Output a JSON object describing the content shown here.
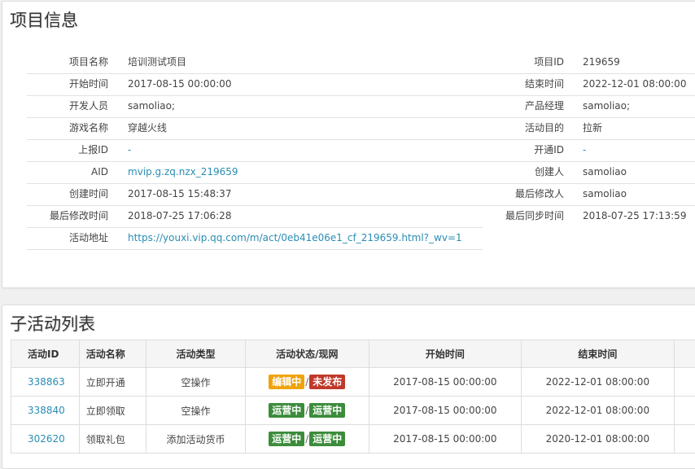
{
  "project_info": {
    "title": "项目信息",
    "left_rows": [
      {
        "label": "项目名称",
        "value": "培训测试项目",
        "link": false
      },
      {
        "label": "开始时间",
        "value": "2017-08-15 00:00:00",
        "link": false
      },
      {
        "label": "开发人员",
        "value": "samoliao;",
        "link": false
      },
      {
        "label": "游戏名称",
        "value": "穿越火线",
        "link": false
      },
      {
        "label": "上报ID",
        "value": "-",
        "link": true
      },
      {
        "label": "AID",
        "value": "mvip.g.zq.nzx_219659",
        "link": true
      },
      {
        "label": "创建时间",
        "value": "2017-08-15 15:48:37",
        "link": false
      },
      {
        "label": "最后修改时间",
        "value": "2018-07-25 17:06:28",
        "link": false
      },
      {
        "label": "活动地址",
        "value": "https://youxi.vip.qq.com/m/act/0eb41e06e1_cf_219659.html?_wv=1",
        "link": true
      }
    ],
    "right_rows": [
      {
        "label": "项目ID",
        "value": "219659",
        "link": false
      },
      {
        "label": "结束时间",
        "value": "2022-12-01 08:00:00",
        "link": false
      },
      {
        "label": "产品经理",
        "value": "samoliao;",
        "link": false
      },
      {
        "label": "活动目的",
        "value": "拉新",
        "link": false
      },
      {
        "label": "开通ID",
        "value": "-",
        "link": true
      },
      {
        "label": "创建人",
        "value": "samoliao",
        "link": false
      },
      {
        "label": "最后修改人",
        "value": "samoliao",
        "link": false
      },
      {
        "label": "最后同步时间",
        "value": "2018-07-25 17:13:59",
        "link": false
      }
    ]
  },
  "sub_activities": {
    "title": "子活动列表",
    "columns": [
      "活动ID",
      "活动名称",
      "活动类型",
      "活动状态/现网",
      "开始时间",
      "结束时间"
    ],
    "rows": [
      {
        "id": "338863",
        "name": "立即开通",
        "type": "空操作",
        "status": {
          "text": "编辑中",
          "color": "#f0a30a"
        },
        "live": {
          "text": "未发布",
          "color": "#c0392b"
        },
        "start": "2017-08-15 00:00:00",
        "end": "2022-12-01 08:00:00"
      },
      {
        "id": "338840",
        "name": "立即领取",
        "type": "空操作",
        "status": {
          "text": "运营中",
          "color": "#3c8c3c"
        },
        "live": {
          "text": "运营中",
          "color": "#3c8c3c"
        },
        "start": "2017-08-15 00:00:00",
        "end": "2022-12-01 08:00:00"
      },
      {
        "id": "302620",
        "name": "领取礼包",
        "type": "添加活动货币",
        "status": {
          "text": "运营中",
          "color": "#3c8c3c"
        },
        "live": {
          "text": "运营中",
          "color": "#3c8c3c"
        },
        "start": "2017-08-15 00:00:00",
        "end": "2020-12-01 08:00:00"
      }
    ],
    "separator": "/"
  }
}
